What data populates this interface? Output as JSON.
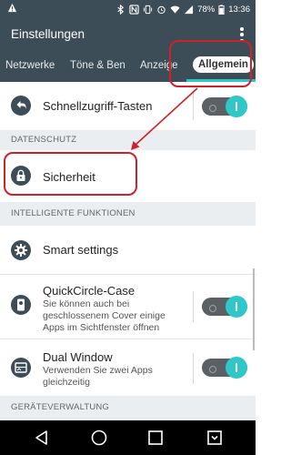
{
  "status_bar": {
    "battery_percent": "78%",
    "time": "13:36",
    "icons": [
      "warning-icon",
      "bluetooth-icon",
      "nfc-icon",
      "vibrate-icon",
      "alarm-icon",
      "wifi-icon",
      "signal-icon",
      "battery-icon"
    ]
  },
  "app_bar": {
    "title": "Einstellungen"
  },
  "tabs": [
    {
      "label": "Netzwerke"
    },
    {
      "label": "Töne & Ben"
    },
    {
      "label": "Anzeige"
    },
    {
      "label": "Allgemein",
      "active": true
    }
  ],
  "list": {
    "row_shortcut": {
      "title": "Schnellzugriff-Tasten",
      "toggle_on": true
    },
    "section_privacy": "DATENSCHUTZ",
    "row_security": {
      "title": "Sicherheit"
    },
    "section_smart": "INTELLIGENTE FUNKTIONEN",
    "row_smart_settings": {
      "title": "Smart settings"
    },
    "row_quickcircle": {
      "title": "QuickCircle-Case",
      "summary": "Sie können auch bei geschlossenem Cover einige Apps im Sichtfenster öffnen",
      "toggle_on": true
    },
    "row_dual_window": {
      "title": "Dual Window",
      "summary": "Verwenden Sie zwei Apps gleichzeitig",
      "toggle_on": true
    },
    "section_device": "GERÄTEVERWALTUNG"
  },
  "colors": {
    "app_bar": "#3d4d57",
    "accent": "#2fc7c7",
    "annotation": "#d0202a",
    "section_bg": "#ebeef0"
  }
}
